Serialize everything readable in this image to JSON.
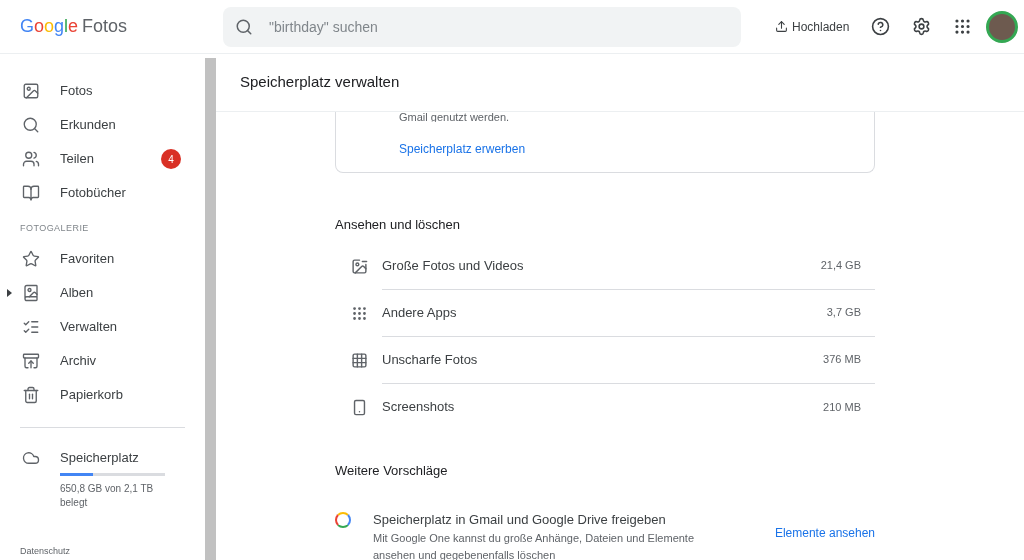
{
  "header": {
    "logo_brand": "Google",
    "logo_product": "Fotos",
    "search": {
      "placeholder": "\"birthday\" suchen"
    },
    "upload": "Hochladen"
  },
  "sidebar": {
    "items": [
      {
        "label": "Fotos",
        "selected": false
      },
      {
        "label": "Erkunden",
        "selected": false
      },
      {
        "label": "Teilen",
        "selected": false,
        "badge": "4"
      },
      {
        "label": "Fotobücher",
        "selected": false
      }
    ],
    "section": "FOTOGALERIE",
    "gallery": [
      {
        "label": "Favoriten",
        "expandable": false
      },
      {
        "label": "Alben",
        "expandable": true
      },
      {
        "label": "Verwalten",
        "expandable": false
      },
      {
        "label": "Archiv",
        "expandable": false
      },
      {
        "label": "Papierkorb",
        "expandable": false
      }
    ],
    "storage": {
      "label": "Speicherplatz",
      "level": 0.31,
      "usage": "650,8 GB von 2,1 TB belegt"
    },
    "footer": "Datenschutz"
  },
  "main": {
    "title": "Speicherplatz verwalten",
    "card": {
      "text": "Gmail genutzt werden.",
      "link": "Speicherplatz erwerben"
    },
    "review": {
      "heading": "Ansehen und löschen",
      "rows": [
        {
          "label": "Große Fotos und Videos",
          "size": "21,4 GB"
        },
        {
          "label": "Andere Apps",
          "size": "3,7 GB"
        },
        {
          "label": "Unscharfe Fotos",
          "size": "376 MB"
        },
        {
          "label": "Screenshots",
          "size": "210 MB"
        }
      ]
    },
    "suggestions": {
      "heading": "Weitere Vorschläge",
      "items": [
        {
          "title": "Speicherplatz in Gmail und Google Drive freigeben",
          "text": "Mit Google One kannst du große Anhänge, Dateien und Elemente ansehen und gegebenenfalls löschen",
          "action": "Elemente ansehen"
        }
      ]
    }
  }
}
